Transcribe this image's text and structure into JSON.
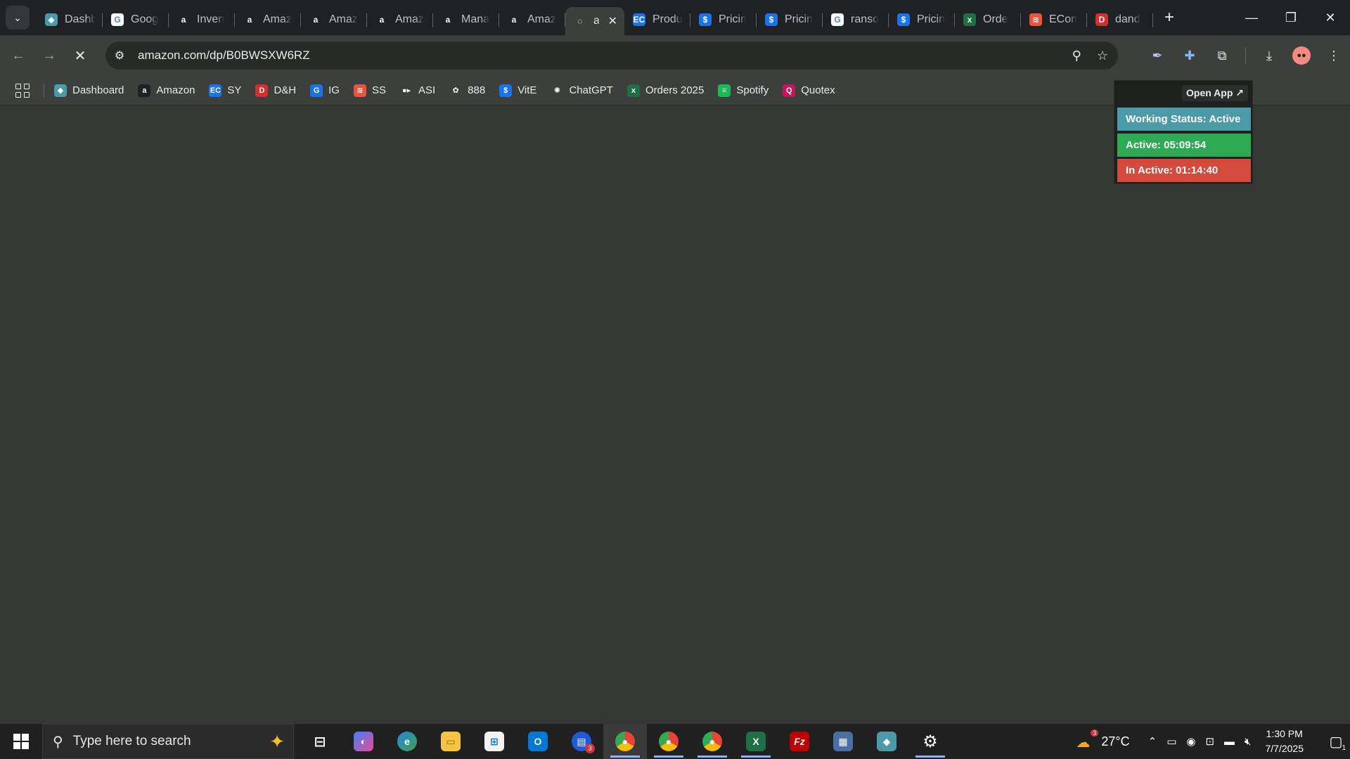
{
  "tabs": [
    {
      "title": "Dashb",
      "fav_icon": "dashboard-icon",
      "fav_color": "#4a9aa9",
      "fav_char": "◆"
    },
    {
      "title": "Goog",
      "fav_icon": "google-lens-icon",
      "fav_color": "#ffffff",
      "fav_char": "G"
    },
    {
      "title": "Inven",
      "fav_icon": "amazon-icon",
      "fav_color": "#202124",
      "fav_char": "a"
    },
    {
      "title": "Amaz",
      "fav_icon": "amazon-icon",
      "fav_color": "#202124",
      "fav_char": "a"
    },
    {
      "title": "Amaz",
      "fav_icon": "amazon-icon",
      "fav_color": "#202124",
      "fav_char": "a"
    },
    {
      "title": "Amaz",
      "fav_icon": "amazon-icon",
      "fav_color": "#202124",
      "fav_char": "a"
    },
    {
      "title": "Mana",
      "fav_icon": "amazon-icon",
      "fav_color": "#202124",
      "fav_char": "a"
    },
    {
      "title": "Amaz",
      "fav_icon": "amazon-icon",
      "fav_color": "#202124",
      "fav_char": "a"
    },
    {
      "title": "a",
      "fav_icon": "loading-icon",
      "fav_color": "#3c3f3c",
      "fav_char": "◌",
      "active": true
    },
    {
      "title": "Produ",
      "fav_icon": "ec-icon",
      "fav_color": "#1a73e8",
      "fav_char": "EC"
    },
    {
      "title": "Pricin",
      "fav_icon": "dollar-icon",
      "fav_color": "#1a73e8",
      "fav_char": "$"
    },
    {
      "title": "Pricin",
      "fav_icon": "dollar-icon",
      "fav_color": "#1a73e8",
      "fav_char": "$"
    },
    {
      "title": "ranso",
      "fav_icon": "google-icon",
      "fav_color": "#ffffff",
      "fav_char": "G"
    },
    {
      "title": "Pricin",
      "fav_icon": "dollar-icon",
      "fav_color": "#1a73e8",
      "fav_char": "$"
    },
    {
      "title": "Orde",
      "fav_icon": "excel-icon",
      "fav_color": "#1d7044",
      "fav_char": "x"
    },
    {
      "title": "ECon",
      "fav_icon": "stack-icon",
      "fav_color": "#e8553a",
      "fav_char": "≋"
    },
    {
      "title": "dand",
      "fav_icon": "dandh-icon",
      "fav_color": "#d32f2f",
      "fav_char": "D"
    }
  ],
  "address": {
    "url": "amazon.com/dp/B0BWSXW6RZ"
  },
  "bookmarks": [
    {
      "label": "Dashboard",
      "icon": "dashboard-icon",
      "color": "#4a9aa9",
      "char": "◆"
    },
    {
      "label": "Amazon",
      "icon": "amazon-icon",
      "color": "#202124",
      "char": "a"
    },
    {
      "label": "SY",
      "icon": "ec-icon",
      "color": "#1a73e8",
      "char": "EC"
    },
    {
      "label": "D&H",
      "icon": "dandh-icon",
      "color": "#d32f2f",
      "char": "D"
    },
    {
      "label": "IG",
      "icon": "ig-icon",
      "color": "#1a73e8",
      "char": "G"
    },
    {
      "label": "SS",
      "icon": "stack-icon",
      "color": "#e8553a",
      "char": "≋"
    },
    {
      "label": "ASI",
      "icon": "asi-icon",
      "color": "#3c3f3c",
      "char": "●▸"
    },
    {
      "label": "888",
      "icon": "888-icon",
      "color": "#3c3f3c",
      "char": "✿"
    },
    {
      "label": "VitE",
      "icon": "dollar-icon",
      "color": "#1a73e8",
      "char": "$"
    },
    {
      "label": "ChatGPT",
      "icon": "chatgpt-icon",
      "color": "#3c3f3c",
      "char": "✺"
    },
    {
      "label": "Orders 2025",
      "icon": "excel-icon",
      "color": "#1d7044",
      "char": "x"
    },
    {
      "label": "Spotify",
      "icon": "spotify-icon",
      "color": "#1db954",
      "char": "≡"
    },
    {
      "label": "Quotex",
      "icon": "quotex-icon",
      "color": "#c2185b",
      "char": "Q"
    }
  ],
  "popup": {
    "open_app": "Open App ↗",
    "working_status": "Working Status: Active",
    "active": "Active: 05:09:54",
    "inactive": "In Active: 01:14:40"
  },
  "taskbar": {
    "search_placeholder": "Type here to search",
    "outlook_badge": "3",
    "weather_badge": "3",
    "temperature": "27°C",
    "time": "1:30 PM",
    "date": "7/7/2025",
    "notification_count": "1"
  }
}
